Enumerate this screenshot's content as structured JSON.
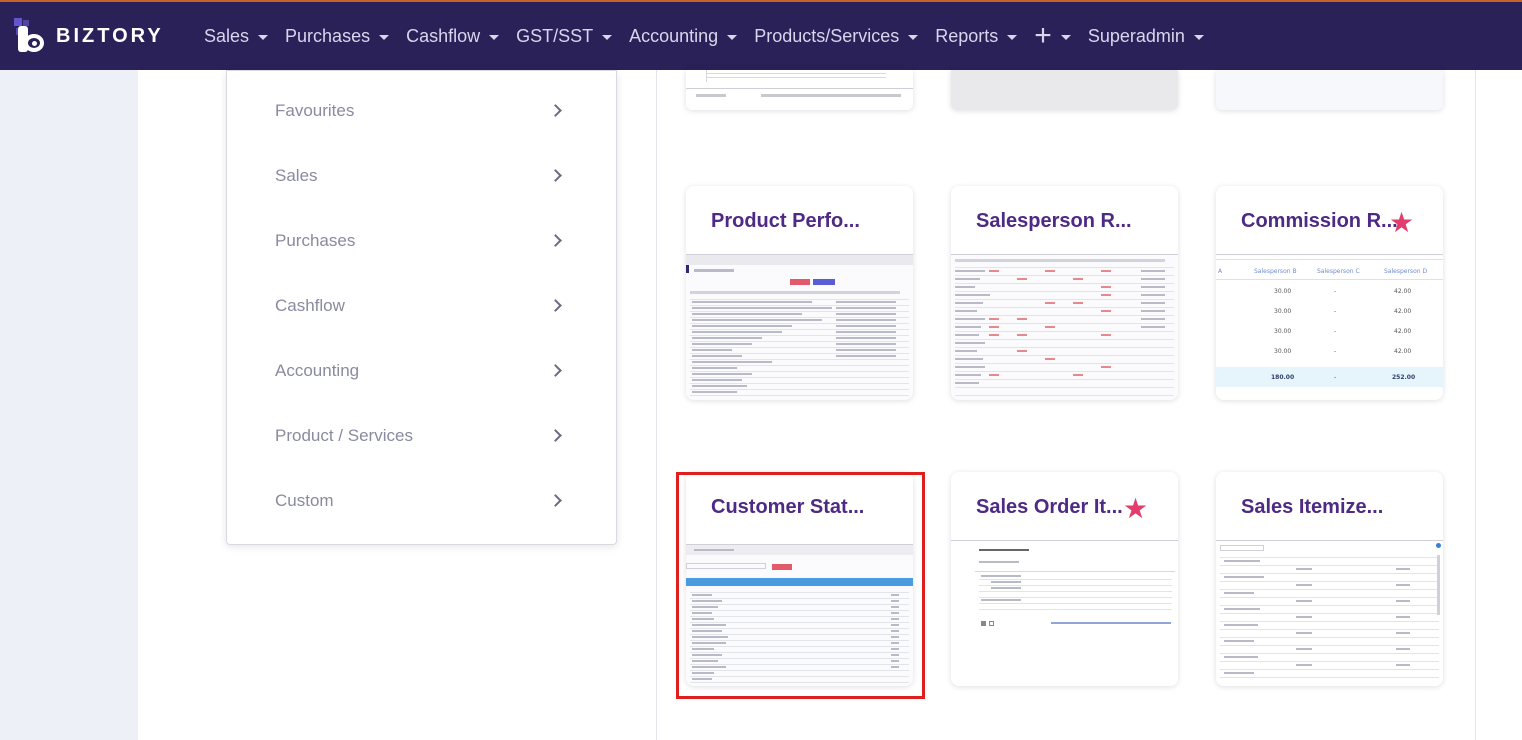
{
  "brand": {
    "name": "BIZTORY"
  },
  "nav": {
    "items": [
      {
        "label": "Sales"
      },
      {
        "label": "Purchases"
      },
      {
        "label": "Cashflow"
      },
      {
        "label": "GST/SST"
      },
      {
        "label": "Accounting"
      },
      {
        "label": "Products/Services"
      },
      {
        "label": "Reports"
      },
      {
        "label": "+"
      },
      {
        "label": "Superadmin"
      }
    ]
  },
  "menu": {
    "items": [
      {
        "label": "Favourites"
      },
      {
        "label": "Sales"
      },
      {
        "label": "Purchases"
      },
      {
        "label": "Cashflow"
      },
      {
        "label": "Accounting"
      },
      {
        "label": "Product / Services"
      },
      {
        "label": "Custom"
      }
    ]
  },
  "cards": [
    {
      "title": "Product Perfo...",
      "favourite": false
    },
    {
      "title": "Salesperson R...",
      "favourite": false
    },
    {
      "title": "Commission R...",
      "favourite": true
    },
    {
      "title": "Customer Stat...",
      "favourite": false,
      "selected": true
    },
    {
      "title": "Sales Order It...",
      "favourite": true
    },
    {
      "title": "Sales Itemize...",
      "favourite": false
    }
  ],
  "thumbnails": {
    "commission": {
      "headers": [
        "Salesperson B",
        "Salesperson C",
        "Salesperson D"
      ],
      "rows": [
        [
          "30.00",
          "-",
          "42.00"
        ],
        [
          "30.00",
          "-",
          "42.00"
        ],
        [
          "30.00",
          "-",
          "42.00"
        ],
        [
          "30.00",
          "-",
          "42.00"
        ]
      ],
      "total": [
        "180.00",
        "-",
        "252.00"
      ]
    }
  },
  "colors": {
    "nav_bg": "#2b2159",
    "title": "#4e2a84",
    "star": "#e23d6d",
    "highlight": "#e01e1e"
  },
  "icons": {
    "star": "star-icon",
    "chevron": "chevron-right-icon",
    "caret": "caret-down-icon"
  }
}
